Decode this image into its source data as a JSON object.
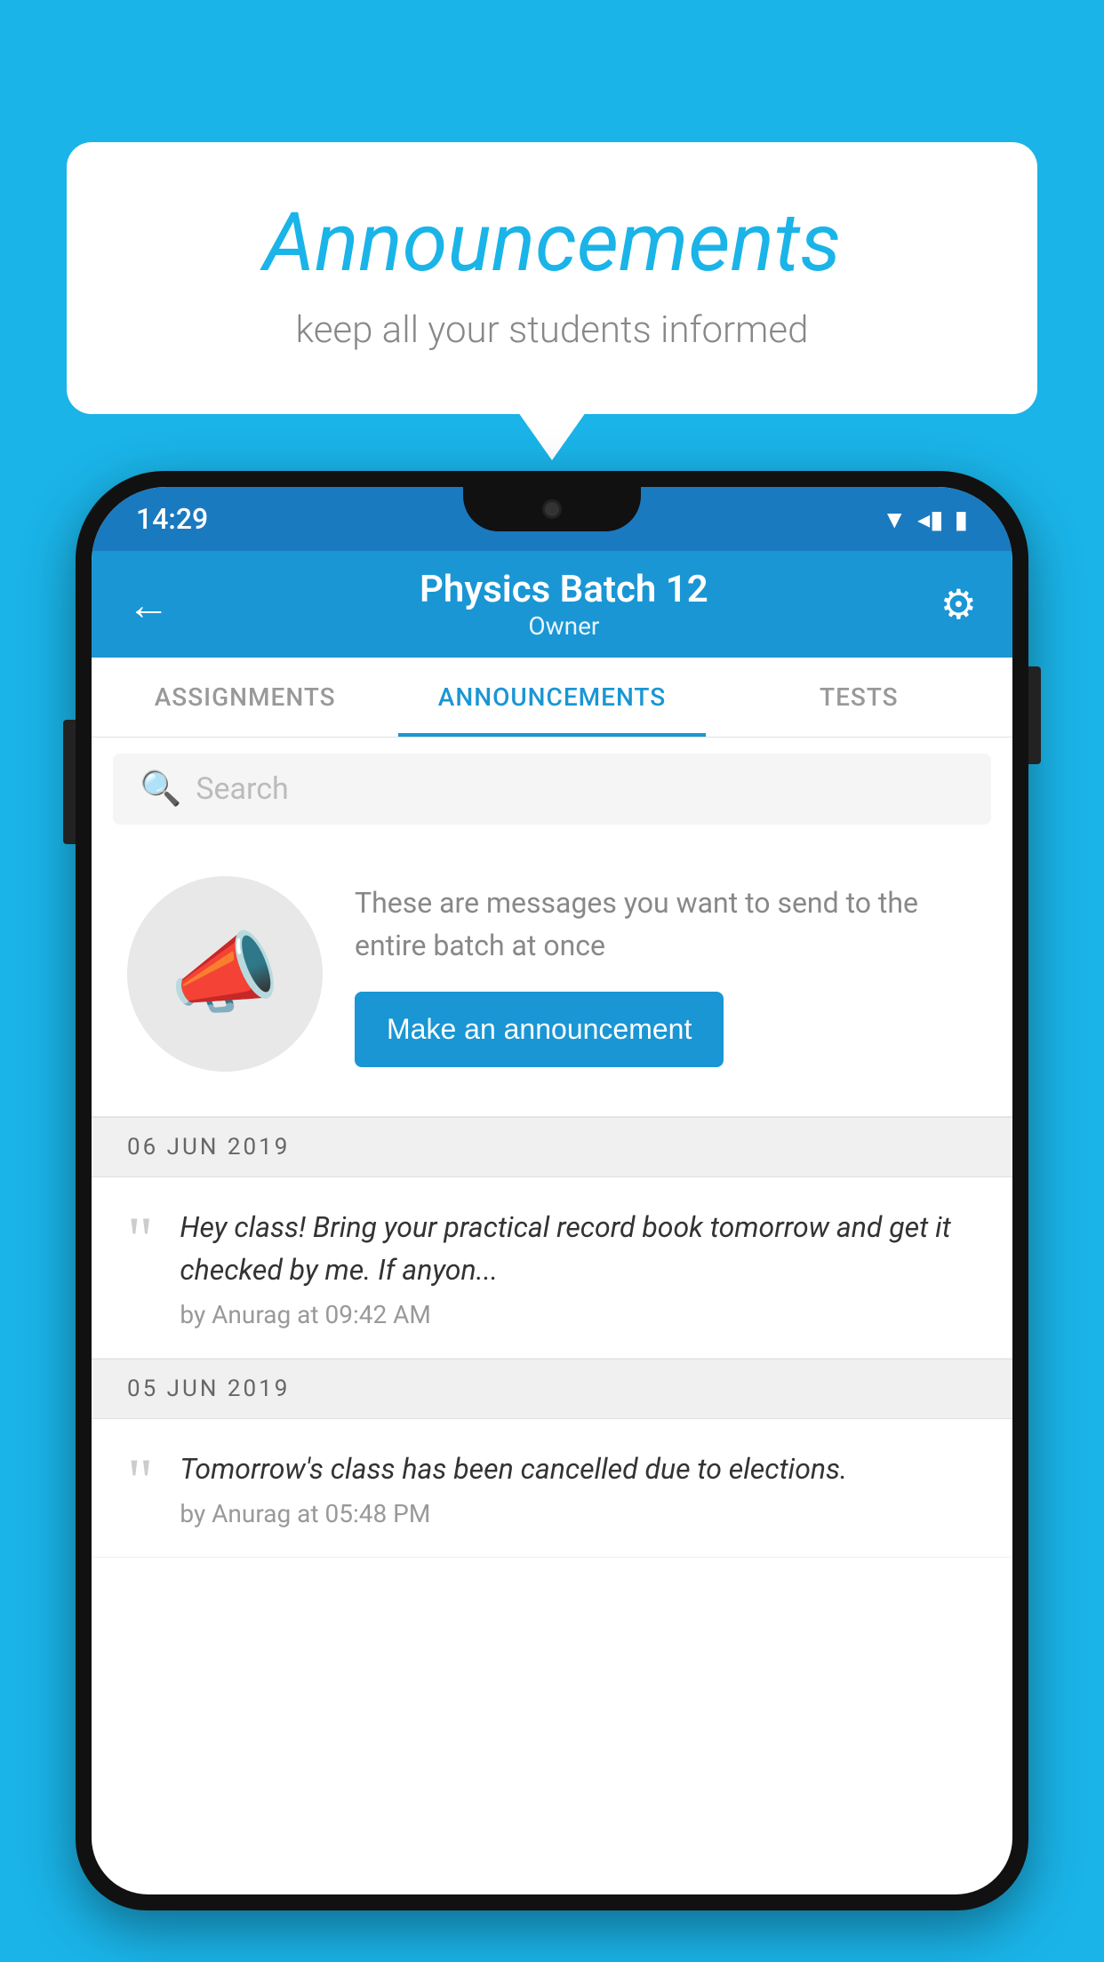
{
  "background_color": "#1ab4e8",
  "speech_bubble": {
    "title": "Announcements",
    "subtitle": "keep all your students informed"
  },
  "phone": {
    "status_bar": {
      "time": "14:29",
      "icons": [
        "wifi",
        "signal",
        "battery"
      ]
    },
    "app_bar": {
      "title": "Physics Batch 12",
      "subtitle": "Owner",
      "back_label": "←",
      "settings_label": "⚙"
    },
    "tabs": [
      {
        "label": "ASSIGNMENTS",
        "active": false
      },
      {
        "label": "ANNOUNCEMENTS",
        "active": true
      },
      {
        "label": "TESTS",
        "active": false
      },
      {
        "label": "",
        "active": false
      }
    ],
    "search": {
      "placeholder": "Search"
    },
    "promo": {
      "text": "These are messages you want to send to the entire batch at once",
      "button_label": "Make an announcement"
    },
    "announcements": [
      {
        "date": "06  JUN  2019",
        "message": "Hey class! Bring your practical record book tomorrow and get it checked by me. If anyon...",
        "meta": "by Anurag at 09:42 AM"
      },
      {
        "date": "05  JUN  2019",
        "message": "Tomorrow's class has been cancelled due to elections.",
        "meta": "by Anurag at 05:48 PM"
      }
    ]
  }
}
